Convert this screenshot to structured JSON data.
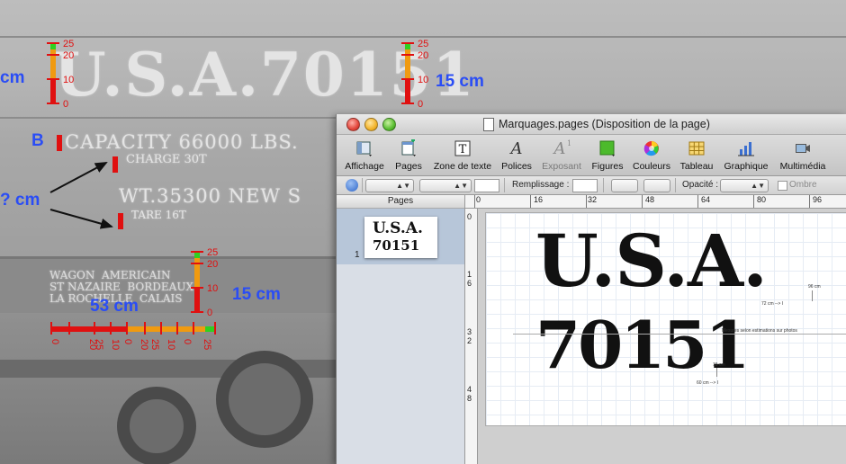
{
  "photo": {
    "painted_usa": "U.S.A.70151",
    "painted_capacity": "CAPACITY 66000 LBS.",
    "painted_charge": "CHARGE 30T",
    "painted_weight": "WT.35300 NEW S",
    "painted_tare": "TARE 16T",
    "painted_wagon": "WAGON  AMERICAIN\nST NAZAIRE  BORDEAUX\nLA ROCHELLE  CALAIS"
  },
  "annotations": {
    "left_cm": "cm",
    "top_right_cm": "15 cm",
    "letter_b": "B",
    "unknown_cm": "? cm",
    "middle_cm": "15 cm",
    "width_cm": "53 cm",
    "ruler_ticks": [
      "25",
      "20",
      "10",
      "0"
    ],
    "hruler_ticks": [
      "0",
      "25",
      "20",
      "10",
      "0",
      "25",
      "20",
      "10",
      "0",
      "25"
    ]
  },
  "window": {
    "title_file": "Marquages.pages",
    "title_mode": " (Disposition de la page)",
    "toolbar": [
      {
        "label": "Affichage",
        "icon": "view-icon"
      },
      {
        "label": "Pages",
        "icon": "pages-icon"
      },
      {
        "label": "Zone de texte",
        "icon": "textbox-icon"
      },
      {
        "label": "Polices",
        "icon": "fonts-icon"
      },
      {
        "label": "Exposant",
        "icon": "superscript-icon"
      },
      {
        "label": "Figures",
        "icon": "shapes-icon"
      },
      {
        "label": "Couleurs",
        "icon": "colors-icon"
      },
      {
        "label": "Tableau",
        "icon": "table-icon"
      },
      {
        "label": "Graphique",
        "icon": "chart-icon"
      },
      {
        "label": "Multimédia",
        "icon": "media-icon"
      }
    ],
    "format_bar": {
      "fill_label": "Remplissage :",
      "opacity_label": "Opacité :",
      "shadow_label": "Ombre"
    },
    "sidebar": {
      "header": "Pages",
      "thumb_line1": "U.S.A.",
      "thumb_line2": "70151",
      "page_number": "1"
    },
    "h_ruler": [
      "0",
      "16",
      "32",
      "48",
      "64",
      "80",
      "96"
    ],
    "v_ruler": [
      "0",
      "1",
      "6",
      "3",
      "2",
      "4",
      "8"
    ],
    "document": {
      "line1": "U.S.A.",
      "line2": "70151",
      "note_96": "96 cm",
      "note_72": "72 cm --> I",
      "note_measures": "Mesures selon estimations sur photos",
      "note_15": "15 cm",
      "note_60": "60 cm -->  I"
    }
  }
}
